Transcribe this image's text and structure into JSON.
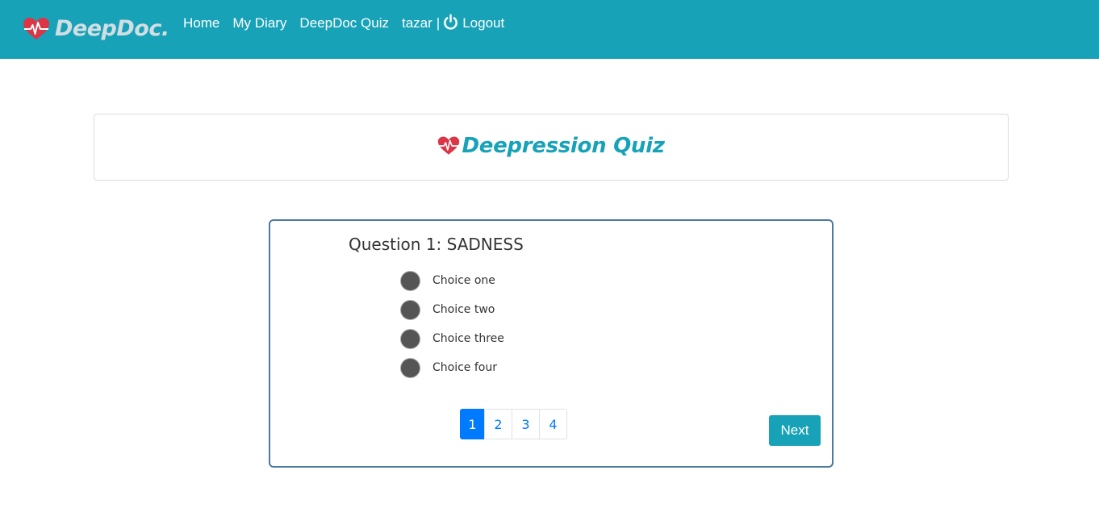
{
  "colors": {
    "navbar": "#17a2b8",
    "heart": "#dc3545",
    "title": "#17a2b8",
    "pagination_active": "#007bff",
    "next_button": "#17a2b8"
  },
  "navbar": {
    "brand": "DeepDoc.",
    "brand_icon": "heart-pulse-icon",
    "links": [
      "Home",
      "My Diary",
      "DeepDoc Quiz"
    ],
    "username": "tazar",
    "separator": "|",
    "logout_icon": "power-icon",
    "logout_label": "Logout"
  },
  "header": {
    "icon": "heart-pulse-icon",
    "title": "Deepression Quiz"
  },
  "quiz": {
    "question": "Question 1: SADNESS",
    "choices": [
      "Choice one",
      "Choice two",
      "Choice three",
      "Choice four"
    ],
    "pages": [
      "1",
      "2",
      "3",
      "4"
    ],
    "active_page": "1",
    "next_label": "Next"
  }
}
